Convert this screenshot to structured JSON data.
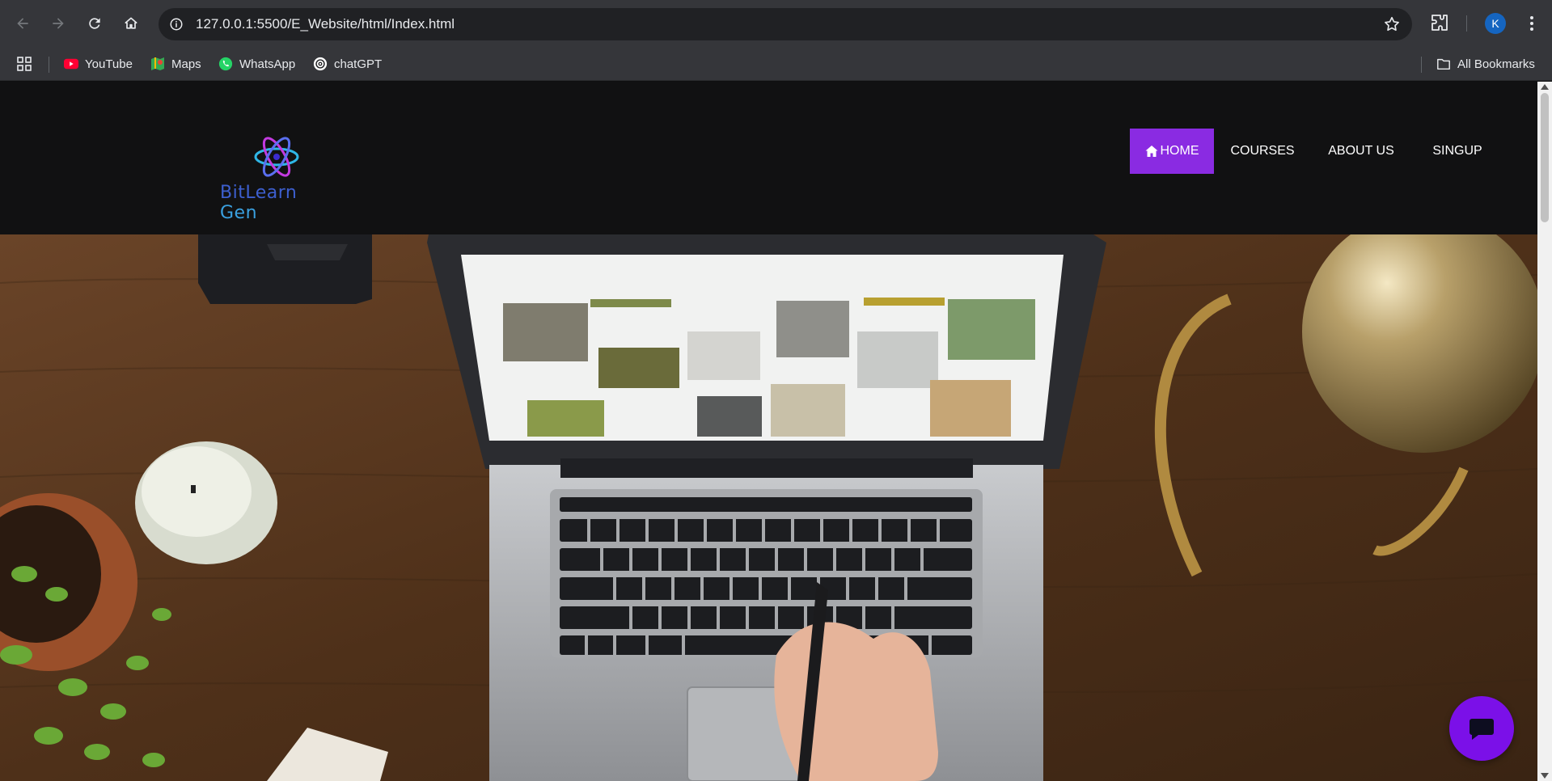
{
  "browser": {
    "url": "127.0.0.1:5500/E_Website/html/Index.html",
    "profile_initial": "K",
    "bookmarks": [
      {
        "label": "YouTube",
        "icon": "youtube-icon"
      },
      {
        "label": "Maps",
        "icon": "maps-icon"
      },
      {
        "label": "WhatsApp",
        "icon": "whatsapp-icon"
      },
      {
        "label": "chatGPT",
        "icon": "chatgpt-icon"
      }
    ],
    "all_bookmarks_label": "All Bookmarks"
  },
  "site": {
    "logo_text_part1": "BitLearn",
    "logo_text_part2": " Gen",
    "nav": [
      {
        "label": "HOME",
        "icon": "home-icon",
        "active": true
      },
      {
        "label": "COURSES",
        "active": false
      },
      {
        "label": "ABOUT US",
        "active": false
      },
      {
        "label": "SINGUP",
        "active": false
      }
    ],
    "accent_color": "#8a2be2",
    "chat_button_color": "#7b10e8"
  }
}
